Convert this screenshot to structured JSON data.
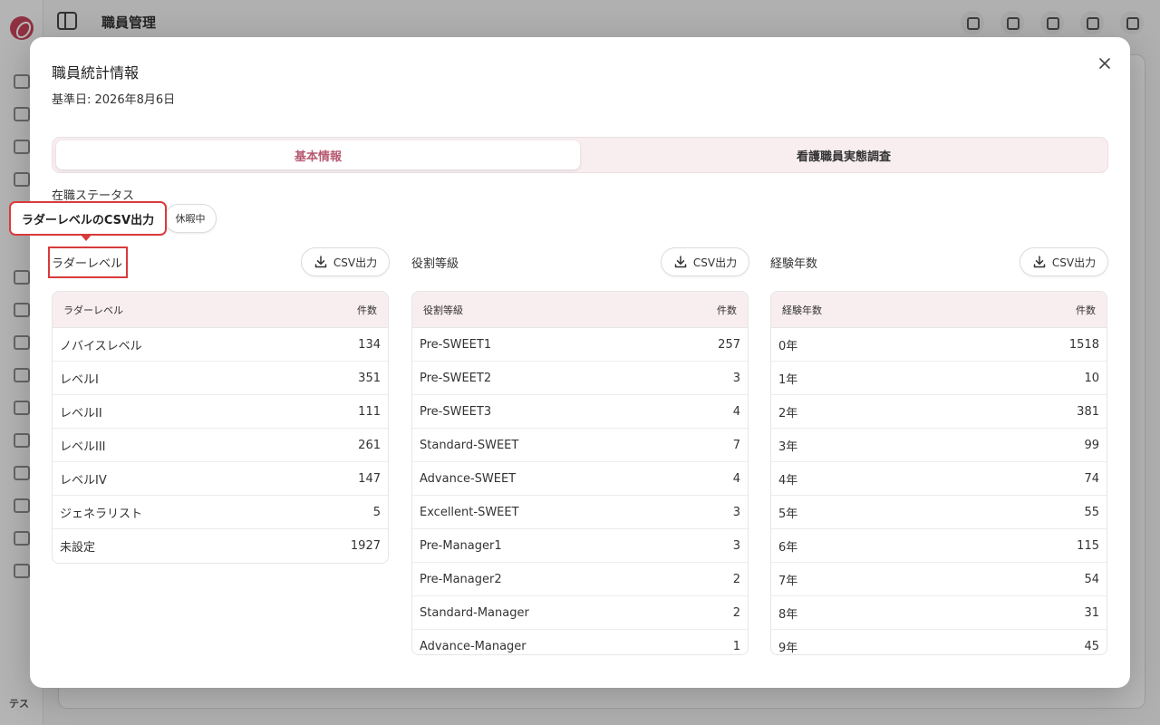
{
  "background": {
    "app_title": "職員管理",
    "user_initials": "テス"
  },
  "modal": {
    "title": "職員統計情報",
    "reference_date": "基準日: 2026年8月6日",
    "tabs": [
      {
        "label": "基本情報",
        "active": true
      },
      {
        "label": "看護職員実態調査",
        "active": false
      }
    ],
    "status_filter": {
      "label": "在職ステータス",
      "chip": "休暇中"
    },
    "tooltip": "ラダーレベルのCSV出力",
    "sections": [
      {
        "title": "ラダーレベル",
        "csv_label": "CSV出力",
        "columns": [
          "ラダーレベル",
          "件数"
        ],
        "rows": [
          [
            "ノバイスレベル",
            "134"
          ],
          [
            "レベルI",
            "351"
          ],
          [
            "レベルII",
            "111"
          ],
          [
            "レベルIII",
            "261"
          ],
          [
            "レベルIV",
            "147"
          ],
          [
            "ジェネラリスト",
            "5"
          ],
          [
            "未設定",
            "1927"
          ]
        ]
      },
      {
        "title": "役割等級",
        "csv_label": "CSV出力",
        "columns": [
          "役割等級",
          "件数"
        ],
        "rows": [
          [
            "Pre-SWEET1",
            "257"
          ],
          [
            "Pre-SWEET2",
            "3"
          ],
          [
            "Pre-SWEET3",
            "4"
          ],
          [
            "Standard-SWEET",
            "7"
          ],
          [
            "Advance-SWEET",
            "4"
          ],
          [
            "Excellent-SWEET",
            "3"
          ],
          [
            "Pre-Manager1",
            "3"
          ],
          [
            "Pre-Manager2",
            "2"
          ],
          [
            "Standard-Manager",
            "2"
          ],
          [
            "Advance-Manager",
            "1"
          ]
        ]
      },
      {
        "title": "経験年数",
        "csv_label": "CSV出力",
        "columns": [
          "経験年数",
          "件数"
        ],
        "rows": [
          [
            "0年",
            "1518"
          ],
          [
            "1年",
            "10"
          ],
          [
            "2年",
            "381"
          ],
          [
            "3年",
            "99"
          ],
          [
            "4年",
            "74"
          ],
          [
            "5年",
            "55"
          ],
          [
            "6年",
            "115"
          ],
          [
            "7年",
            "54"
          ],
          [
            "8年",
            "31"
          ],
          [
            "9年",
            "45"
          ]
        ]
      }
    ]
  },
  "colors": {
    "accent": "#b65a72",
    "tab_bg": "#f8eef0",
    "highlight": "#d93a3a"
  }
}
